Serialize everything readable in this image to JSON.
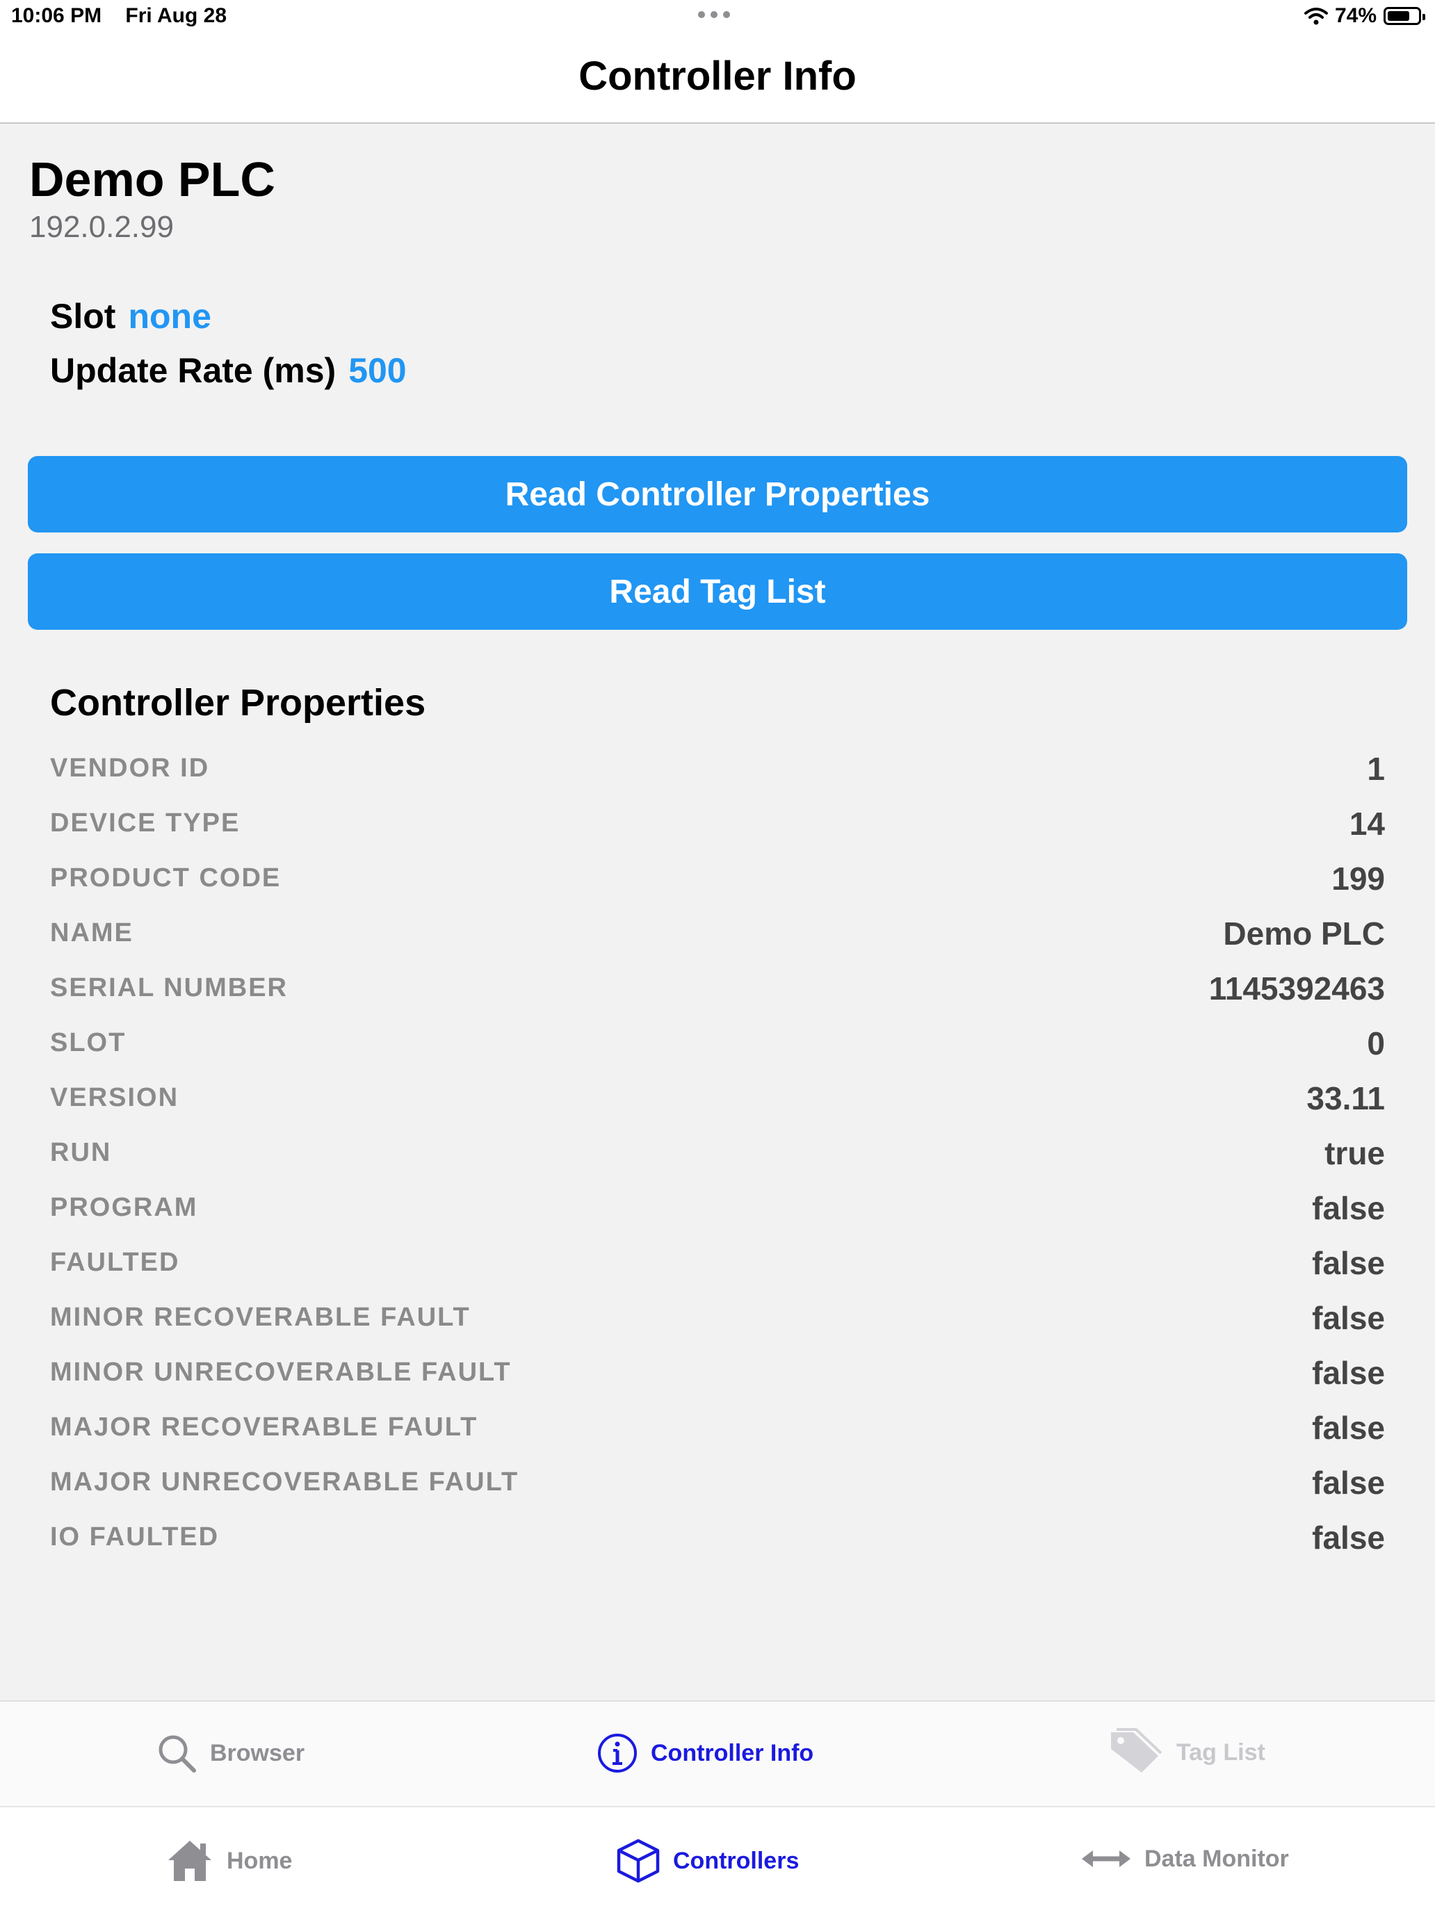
{
  "status_bar": {
    "time": "10:06 PM",
    "date": "Fri Aug 28",
    "battery": "74%",
    "battery_level": 0.74
  },
  "nav": {
    "title": "Controller Info"
  },
  "device": {
    "name": "Demo PLC",
    "ip": "192.0.2.99"
  },
  "settings": {
    "slot_label": "Slot",
    "slot_value": "none",
    "rate_label": "Update Rate (ms)",
    "rate_value": "500"
  },
  "buttons": {
    "read_props": "Read Controller Properties",
    "read_tags": "Read Tag List"
  },
  "properties": {
    "title": "Controller Properties",
    "rows": [
      {
        "label": "VENDOR ID",
        "value": "1"
      },
      {
        "label": "DEVICE TYPE",
        "value": "14"
      },
      {
        "label": "PRODUCT CODE",
        "value": "199"
      },
      {
        "label": "NAME",
        "value": "Demo PLC"
      },
      {
        "label": "SERIAL NUMBER",
        "value": "1145392463"
      },
      {
        "label": "SLOT",
        "value": "0"
      },
      {
        "label": "VERSION",
        "value": "33.11"
      },
      {
        "label": "RUN",
        "value": "true"
      },
      {
        "label": "PROGRAM",
        "value": "false"
      },
      {
        "label": "FAULTED",
        "value": "false"
      },
      {
        "label": "MINOR RECOVERABLE FAULT",
        "value": "false"
      },
      {
        "label": "MINOR UNRECOVERABLE FAULT",
        "value": "false"
      },
      {
        "label": "MAJOR RECOVERABLE FAULT",
        "value": "false"
      },
      {
        "label": "MAJOR UNRECOVERABLE FAULT",
        "value": "false"
      },
      {
        "label": "IO FAULTED",
        "value": "false"
      }
    ]
  },
  "inner_tabs": [
    {
      "label": "Browser",
      "icon": "search-icon"
    },
    {
      "label": "Controller Info",
      "icon": "info-icon"
    },
    {
      "label": "Tag List",
      "icon": "tag-icon"
    }
  ],
  "outer_tabs": [
    {
      "label": "Home",
      "icon": "home-icon"
    },
    {
      "label": "Controllers",
      "icon": "cube-icon"
    },
    {
      "label": "Data Monitor",
      "icon": "double-arrow-icon"
    }
  ],
  "colors": {
    "accent": "#2196f3",
    "tab_active": "#1a1adf",
    "tab_inactive": "#8e8e93",
    "tab_disabled": "#c7c7cc"
  }
}
